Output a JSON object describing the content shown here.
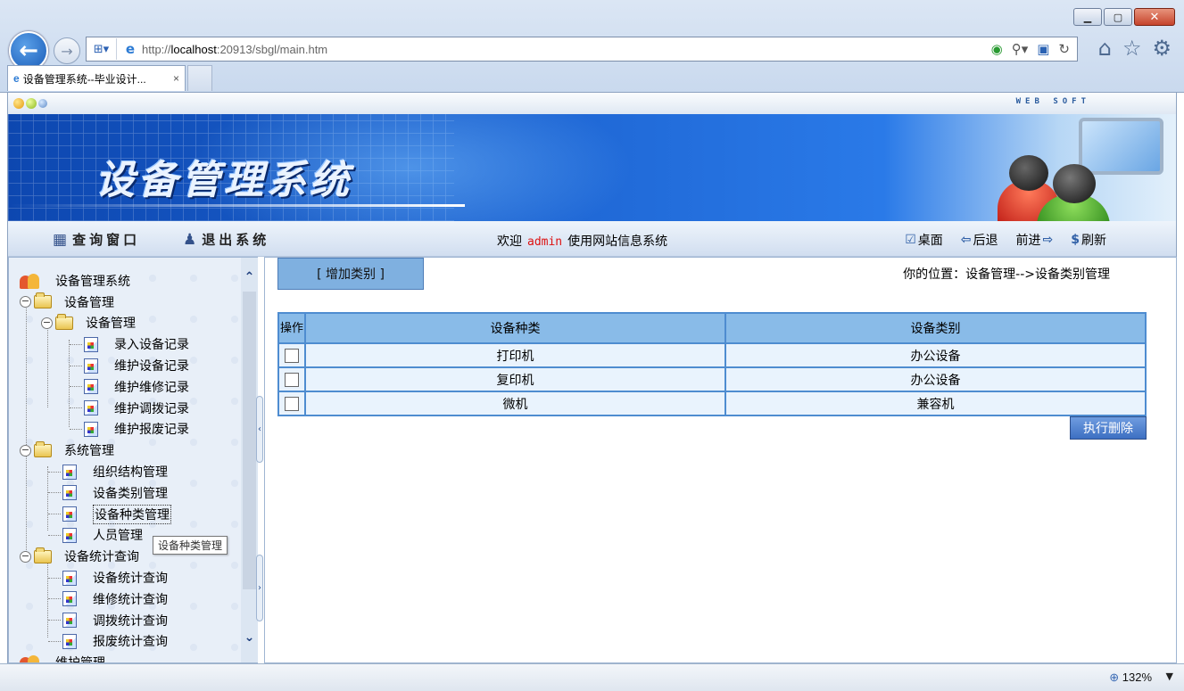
{
  "browser": {
    "url_prefix": "http://",
    "url_host": "localhost",
    "url_rest": ":20913/sbgl/main.htm",
    "tab_title": "设备管理系统--毕业设计...",
    "tab_close": "×",
    "zoom": "132%"
  },
  "header": {
    "websoft": "WEB SOFT",
    "banner_title": "设备管理系统"
  },
  "nav": {
    "query": "查询窗口",
    "exit": "退出系统",
    "welcome_prefix": "欢迎",
    "user": "admin",
    "welcome_suffix": "使用网站信息系统",
    "desktop": "桌面",
    "back": "后退",
    "forward": "前进",
    "refresh": "刷新"
  },
  "sidebar": {
    "root": "设备管理系统",
    "groups": [
      {
        "label": "设备管理"
      },
      {
        "label": "设备管理"
      },
      {
        "label": "系统管理"
      },
      {
        "label": "设备统计查询"
      },
      {
        "label": "维护管理"
      }
    ],
    "items": [
      "录入设备记录",
      "维护设备记录",
      "维护维修记录",
      "维护调拨记录",
      "维护报废记录",
      "组织结构管理",
      "设备类别管理",
      "设备种类管理",
      "人员管理",
      "设备统计查询",
      "维修统计查询",
      "调拨统计查询",
      "报废统计查询"
    ],
    "tooltip": "设备种类管理"
  },
  "main": {
    "add_button": "[ 增加类别 ]",
    "position": "你的位置：设备管理-->设备类别管理",
    "columns": [
      "操作",
      "设备种类",
      "设备类别"
    ],
    "rows": [
      {
        "kind": "打印机",
        "category": "办公设备"
      },
      {
        "kind": "复印机",
        "category": "办公设备"
      },
      {
        "kind": "微机",
        "category": "兼容机"
      }
    ],
    "delete_button": "执行删除"
  }
}
